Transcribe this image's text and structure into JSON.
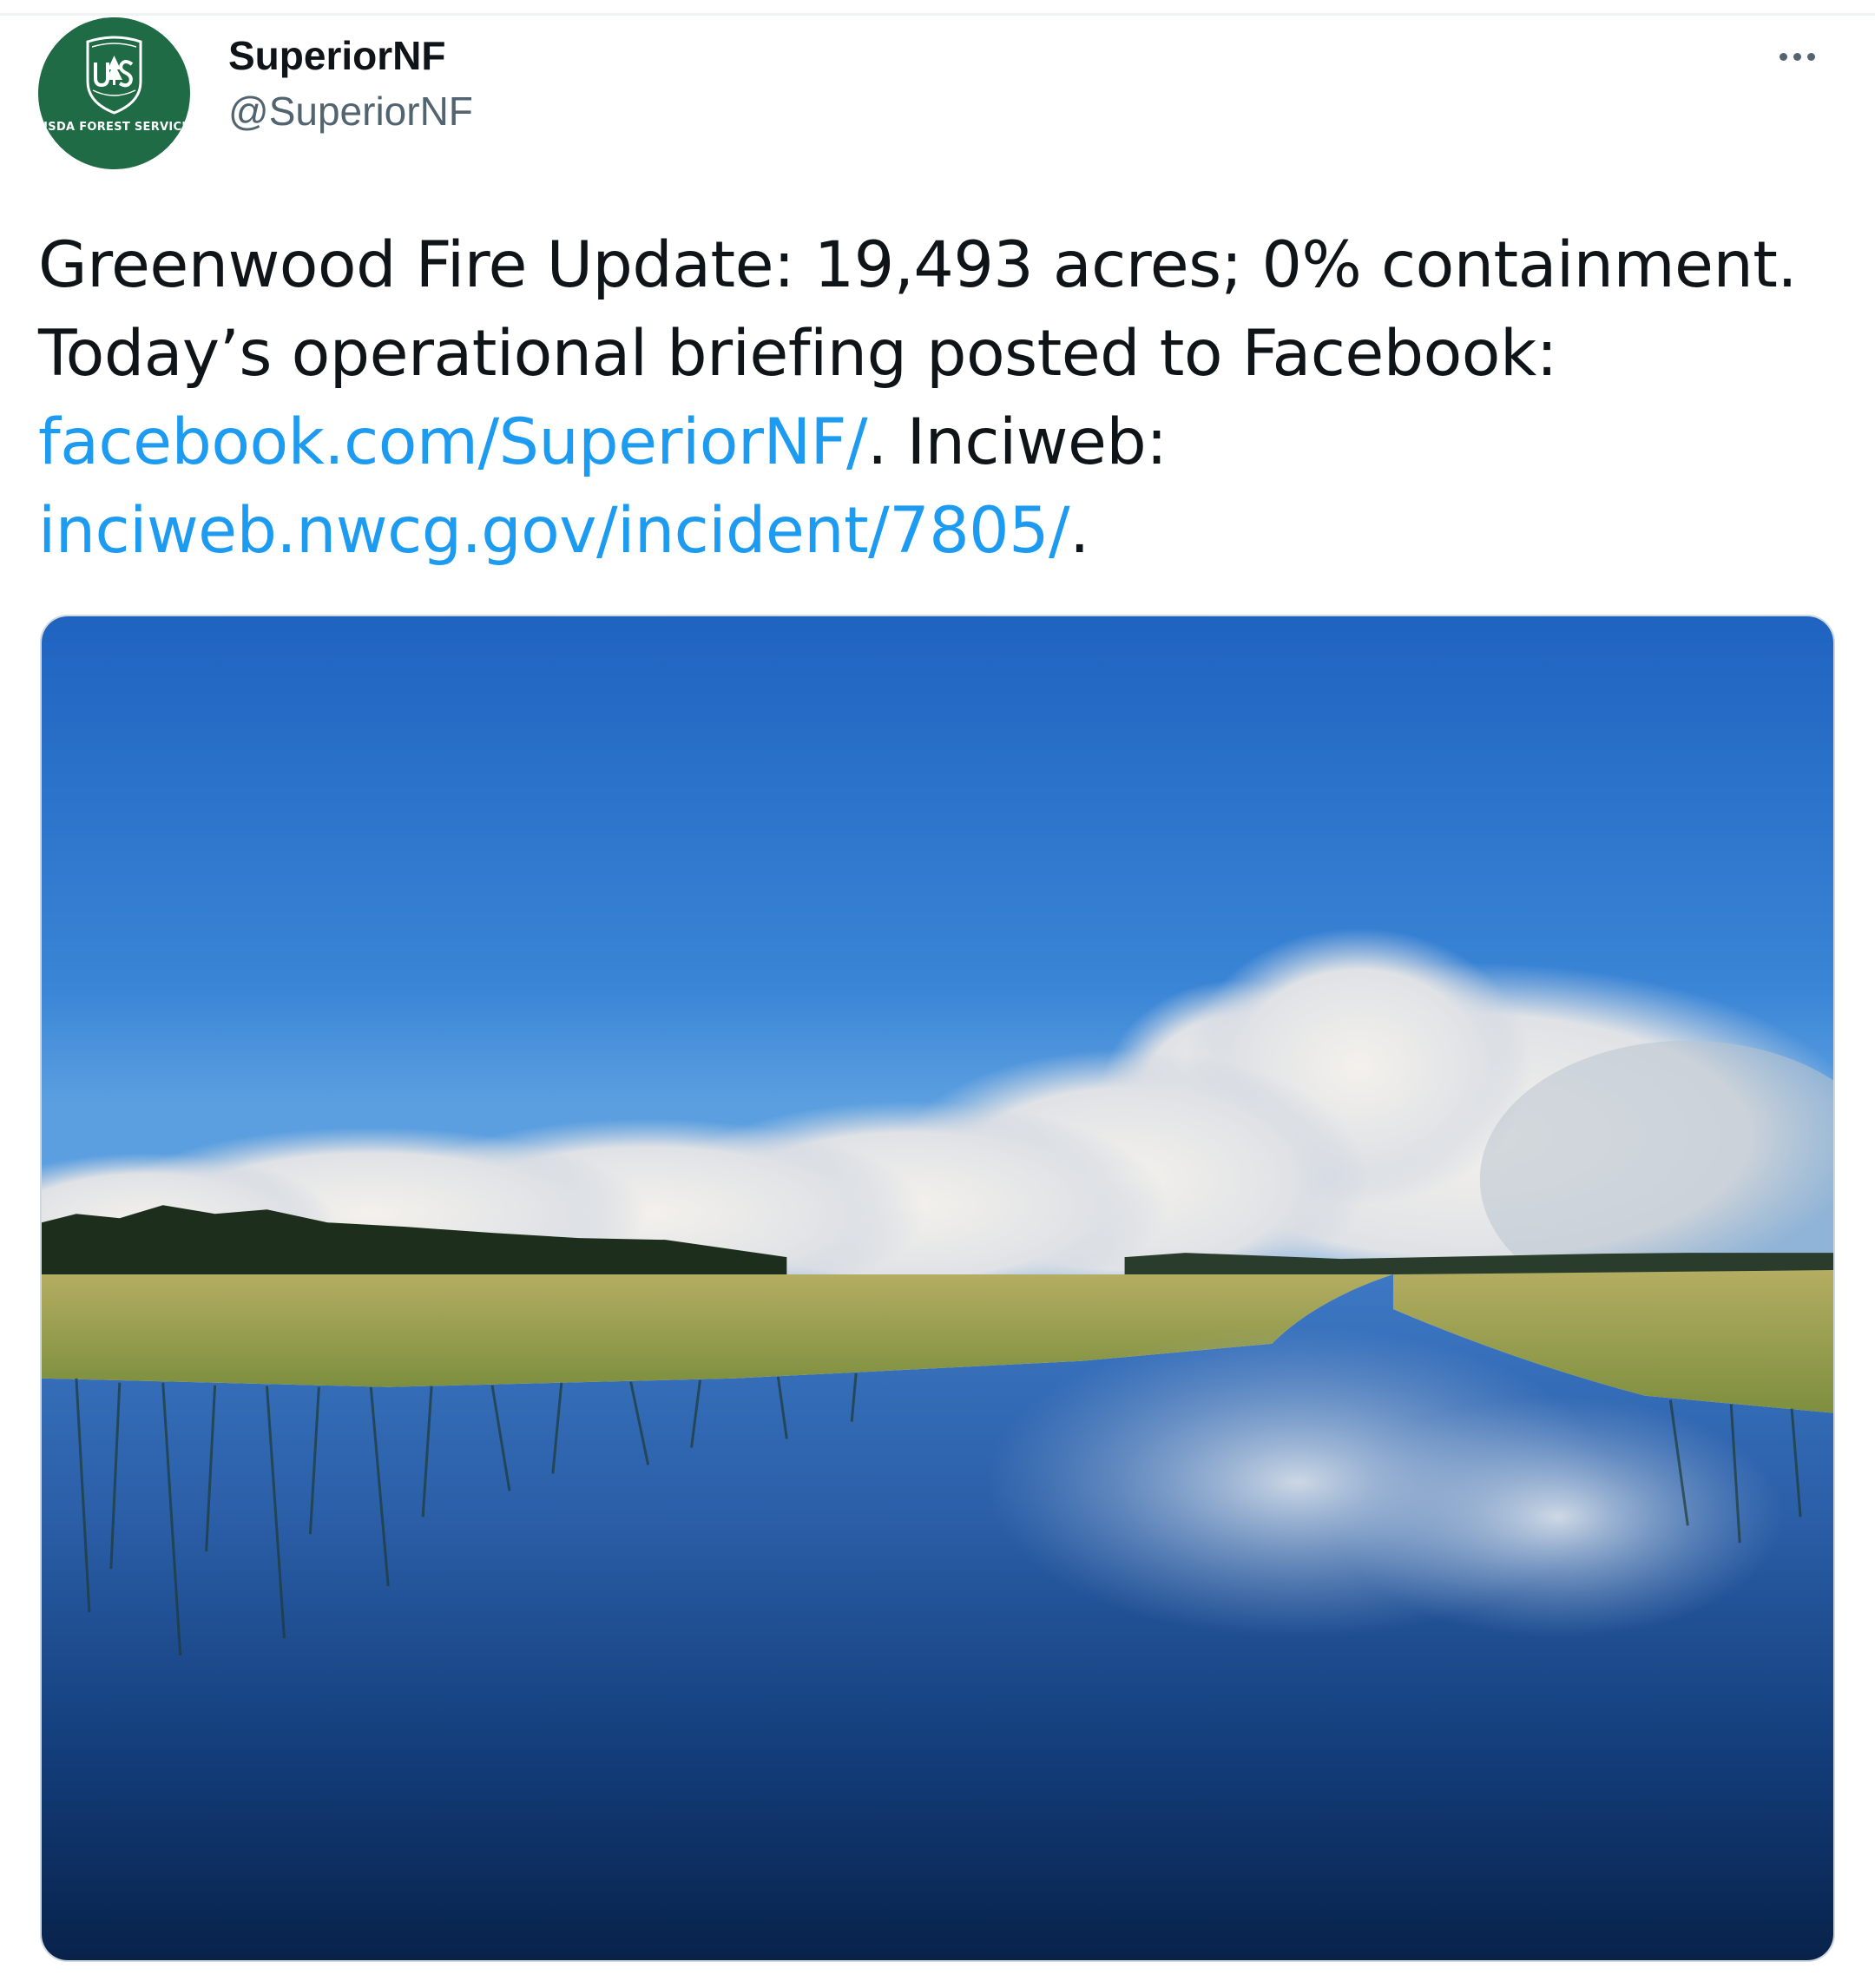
{
  "account": {
    "display_name": "SuperiorNF",
    "handle": "@SuperiorNF",
    "avatar": {
      "icon": "usda-forest-service-shield-icon",
      "caption": "USDA FOREST SERVICE",
      "background_color": "#1f6b45"
    }
  },
  "menu": {
    "more_icon": "more-dots-icon"
  },
  "tweet": {
    "text_part1": "Greenwood Fire Update:  19,493 acres; 0% containment.  Today’s operational briefing posted to Facebook: ",
    "link1": "facebook.com/SuperiorNF/",
    "text_part2": ".   Inciweb: ",
    "link2": "inciweb.nwcg.gov/incident/7805/",
    "text_part3": ".",
    "link_color": "#1d9bf0"
  },
  "media": {
    "type": "photo",
    "subject": "photo-lake-wildfire-smoke"
  }
}
